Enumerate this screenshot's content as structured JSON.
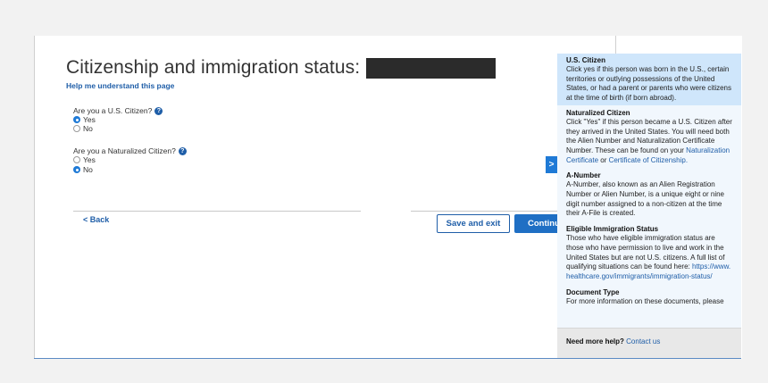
{
  "page": {
    "title": "Citizenship and immigration status:",
    "help_link": "Help me understand this page"
  },
  "questions": {
    "q1": {
      "label": "Are you a U.S. Citizen?",
      "options": [
        {
          "label": "Yes",
          "checked": true
        },
        {
          "label": "No",
          "checked": false
        }
      ]
    },
    "q2": {
      "label": "Are you a Naturalized Citizen?",
      "options": [
        {
          "label": "Yes",
          "checked": false
        },
        {
          "label": "No",
          "checked": true
        }
      ]
    }
  },
  "nav": {
    "back": "< Back",
    "save_exit": "Save and exit",
    "continue": "Continue",
    "toggle_glyph": ">"
  },
  "help_panel": {
    "sections": {
      "us_citizen": {
        "title": "U.S. Citizen",
        "body": "Click yes if this person was born in the U.S., certain territories or outlying possessions of the United States, or had a parent or parents who were citizens at the time of birth (if born abroad)."
      },
      "naturalized": {
        "title": "Naturalized Citizen",
        "body": "Click \"Yes\" if this person became a U.S. Citizen after they arrived in the United States. You will need both the Alien Number and Naturalization Certificate Number. These can be found on your",
        "link1": "Naturalization Certificate",
        "or": " or ",
        "link2": "Certificate of Citizenship."
      },
      "a_number": {
        "title": "A-Number",
        "body": "A-Number, also known as an Alien Registration Number or Alien Number, is a unique eight or nine digit number assigned to a non-citizen at the time their A-File is created."
      },
      "eligible": {
        "title": "Eligible Immigration Status",
        "body": "Those who have eligible immigration status are those who have permission to live and work in the United States but are not U.S. citizens. A full list of qualifying situations can be found here:",
        "link": "https://www.healthcare.gov/immigrants/immigration-status/"
      },
      "document_type": {
        "title": "Document Type",
        "body": "For more information on these documents, please"
      }
    },
    "footer": {
      "label": "Need more help?",
      "link": "Contact us"
    }
  },
  "colors": {
    "accent": "#1f6fc4",
    "link": "#1f5ea8",
    "panel_bg": "#f1f7fd",
    "panel_highlight": "#cfe6fb"
  }
}
